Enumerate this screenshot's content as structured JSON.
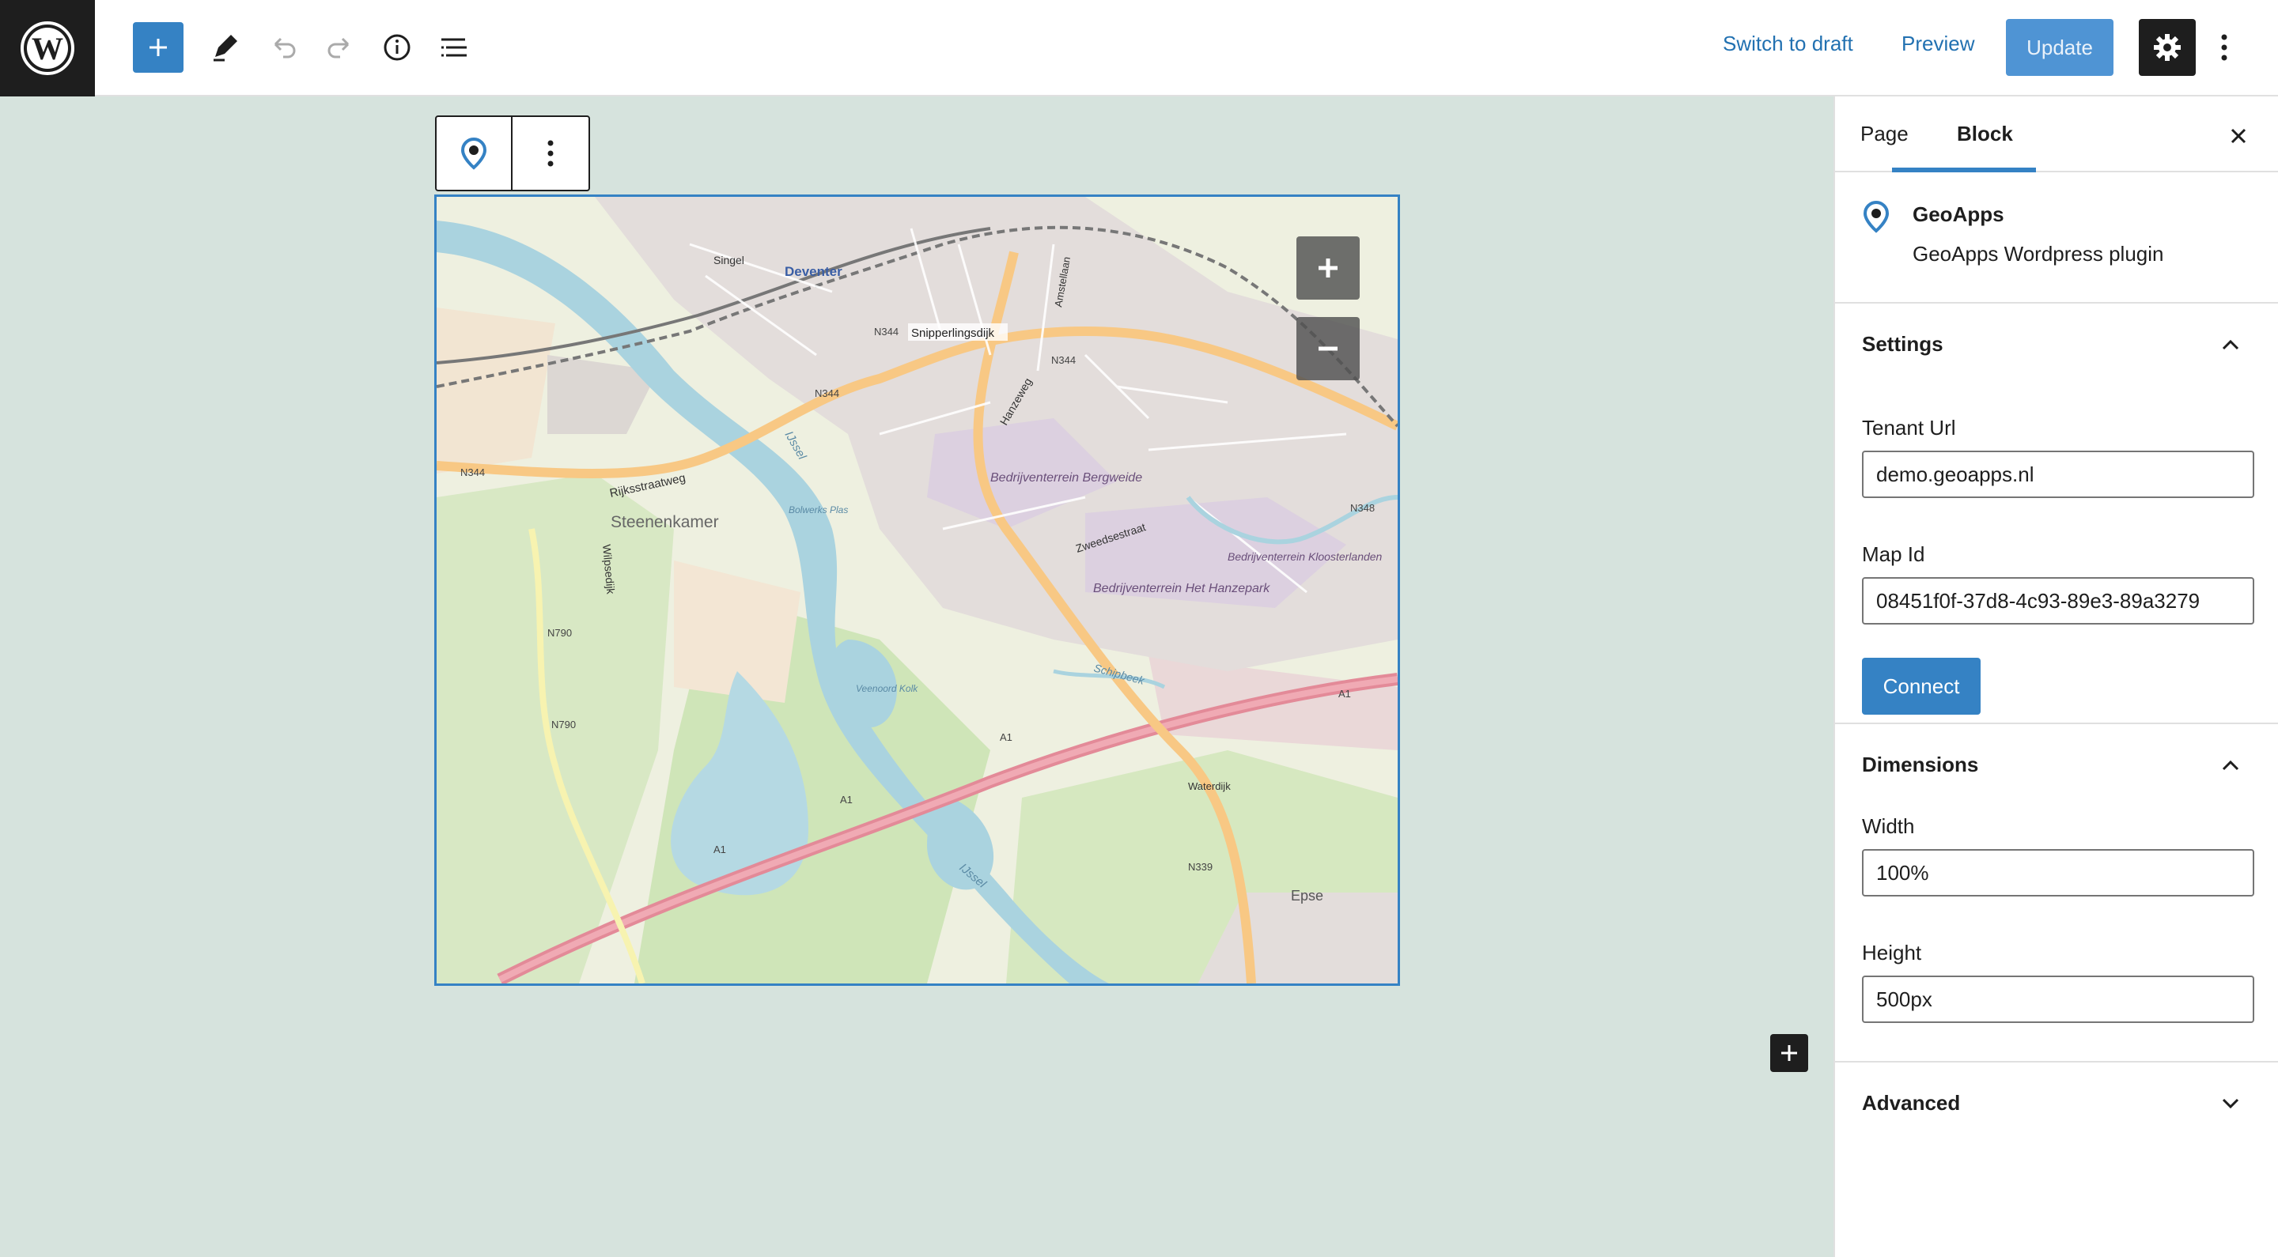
{
  "topbar": {
    "switch_to_draft": "Switch to draft",
    "preview": "Preview",
    "update": "Update",
    "icons": [
      "wordpress-logo",
      "plus-icon",
      "pencil-icon",
      "undo-icon",
      "redo-icon",
      "info-icon",
      "list-view-icon",
      "gear-icon",
      "more-vertical-icon"
    ]
  },
  "map": {
    "labels": {
      "deventer": "Deventer",
      "snipperlingsdijk": "Snipperlingsdijk",
      "n344": "N344",
      "n348": "N348",
      "n790": "N790",
      "n339": "N339",
      "a1": "A1",
      "steenenkamer": "Steenenkamer",
      "rijksstraatweg": "Rijksstraatweg",
      "bergweide": "Bedrijventerrein Bergweide",
      "hanzepark": "Bedrijventerrein Het Hanzepark",
      "kloosterlanden": "Bedrijventerrein Kloosterlanden",
      "ijssel": "IJssel",
      "epse": "Epse",
      "hanzeweg": "Hanzeweg",
      "amstellaan": "Amstellaan",
      "zweedsestraat": "Zweedsestraat",
      "wilpsedijk": "Wilpsedijk",
      "bolwerksplas": "Bolwerks Plas",
      "veenoord": "Veenoord Kolk",
      "schipbeek": "Schipbeek",
      "waterdijk": "Waterdijk",
      "singel": "Singel"
    },
    "zoom_in": "+",
    "zoom_out": "−"
  },
  "sidebar": {
    "tabs": [
      "Page",
      "Block"
    ],
    "active_tab": "Block",
    "block": {
      "name": "GeoApps",
      "description": "GeoApps Wordpress plugin"
    },
    "settings": {
      "title": "Settings",
      "tenant_label": "Tenant Url",
      "tenant_value": "demo.geoapps.nl",
      "mapid_label": "Map Id",
      "mapid_value": "08451f0f-37d8-4c93-89e3-89a3279",
      "connect": "Connect"
    },
    "dimensions": {
      "title": "Dimensions",
      "width_label": "Width",
      "width_value": "100%",
      "height_label": "Height",
      "height_value": "500px"
    },
    "advanced": {
      "title": "Advanced"
    }
  },
  "colors": {
    "accent": "#3582c4",
    "canvas_bg": "#d6e3dd",
    "dark": "#1e1e1e"
  }
}
